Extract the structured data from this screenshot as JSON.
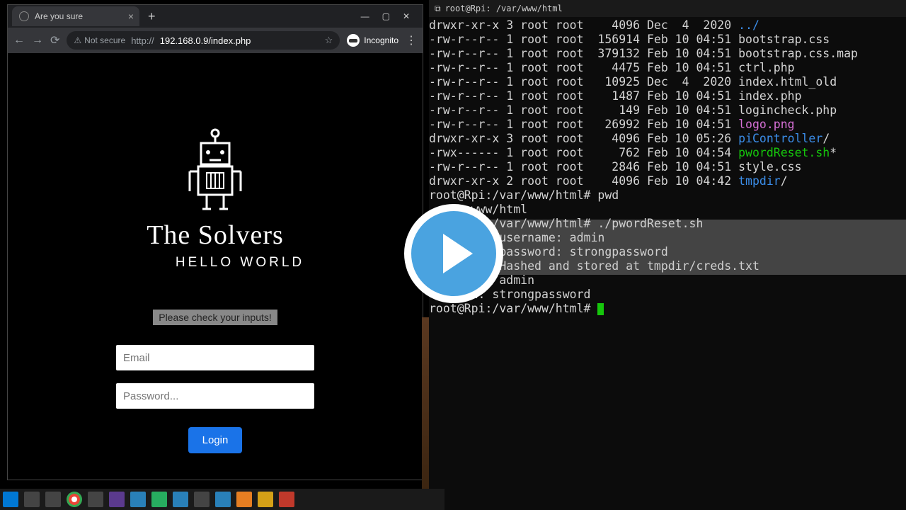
{
  "browser": {
    "tab_title": "Are you sure",
    "not_secure": "Not secure",
    "url": "192.168.0.9/index.php",
    "url_prefix": "http://",
    "incognito": "Incognito"
  },
  "page": {
    "brand": "The Solvers",
    "hello": "HELLO WORLD",
    "error": "Please check your inputs!",
    "email_placeholder": "Email",
    "password_placeholder": "Password...",
    "login_label": "Login"
  },
  "terminal": {
    "title": "root@Rpi: /var/www/html",
    "ls": [
      {
        "perm": "drwxr-xr-x",
        "n": "3",
        "o": "root",
        "g": "root",
        "size": "4096",
        "date": "Dec  4  2020",
        "name": "../",
        "cls": "c-blue"
      },
      {
        "perm": "-rw-r--r--",
        "n": "1",
        "o": "root",
        "g": "root",
        "size": "156914",
        "date": "Feb 10 04:51",
        "name": "bootstrap.css",
        "cls": ""
      },
      {
        "perm": "-rw-r--r--",
        "n": "1",
        "o": "root",
        "g": "root",
        "size": "379132",
        "date": "Feb 10 04:51",
        "name": "bootstrap.css.map",
        "cls": ""
      },
      {
        "perm": "-rw-r--r--",
        "n": "1",
        "o": "root",
        "g": "root",
        "size": "4475",
        "date": "Feb 10 04:51",
        "name": "ctrl.php",
        "cls": ""
      },
      {
        "perm": "-rw-r--r--",
        "n": "1",
        "o": "root",
        "g": "root",
        "size": "10925",
        "date": "Dec  4  2020",
        "name": "index.html_old",
        "cls": ""
      },
      {
        "perm": "-rw-r--r--",
        "n": "1",
        "o": "root",
        "g": "root",
        "size": "1487",
        "date": "Feb 10 04:51",
        "name": "index.php",
        "cls": ""
      },
      {
        "perm": "-rw-r--r--",
        "n": "1",
        "o": "root",
        "g": "root",
        "size": "149",
        "date": "Feb 10 04:51",
        "name": "logincheck.php",
        "cls": ""
      },
      {
        "perm": "-rw-r--r--",
        "n": "1",
        "o": "root",
        "g": "root",
        "size": "26992",
        "date": "Feb 10 04:51",
        "name": "logo.png",
        "cls": "c-magenta"
      },
      {
        "perm": "drwxr-xr-x",
        "n": "3",
        "o": "root",
        "g": "root",
        "size": "4096",
        "date": "Feb 10 05:26",
        "name": "piController",
        "cls": "c-blue",
        "suffix": "/"
      },
      {
        "perm": "-rwx------",
        "n": "1",
        "o": "root",
        "g": "root",
        "size": "762",
        "date": "Feb 10 04:54",
        "name": "pwordReset.sh",
        "cls": "c-green",
        "suffix": "*"
      },
      {
        "perm": "-rw-r--r--",
        "n": "1",
        "o": "root",
        "g": "root",
        "size": "2846",
        "date": "Feb 10 04:51",
        "name": "style.css",
        "cls": ""
      },
      {
        "perm": "drwxr-xr-x",
        "n": "2",
        "o": "root",
        "g": "root",
        "size": "4096",
        "date": "Feb 10 04:42",
        "name": "tmpdir",
        "cls": "c-blue",
        "suffix": "/"
      }
    ],
    "prompt": "root@Rpi:/var/www/html#",
    "cmd_pwd": "pwd",
    "pwd_out": "/var/www/html",
    "cmd_reset": "./pwordReset.sh",
    "line_user": "username: admin",
    "line_pass": "password: strongpassword",
    "line_hashed": "s Hashed and stored at tmpdir/creds.txt",
    "line_admin": "admin",
    "line_strong": "d: strongpassword"
  }
}
